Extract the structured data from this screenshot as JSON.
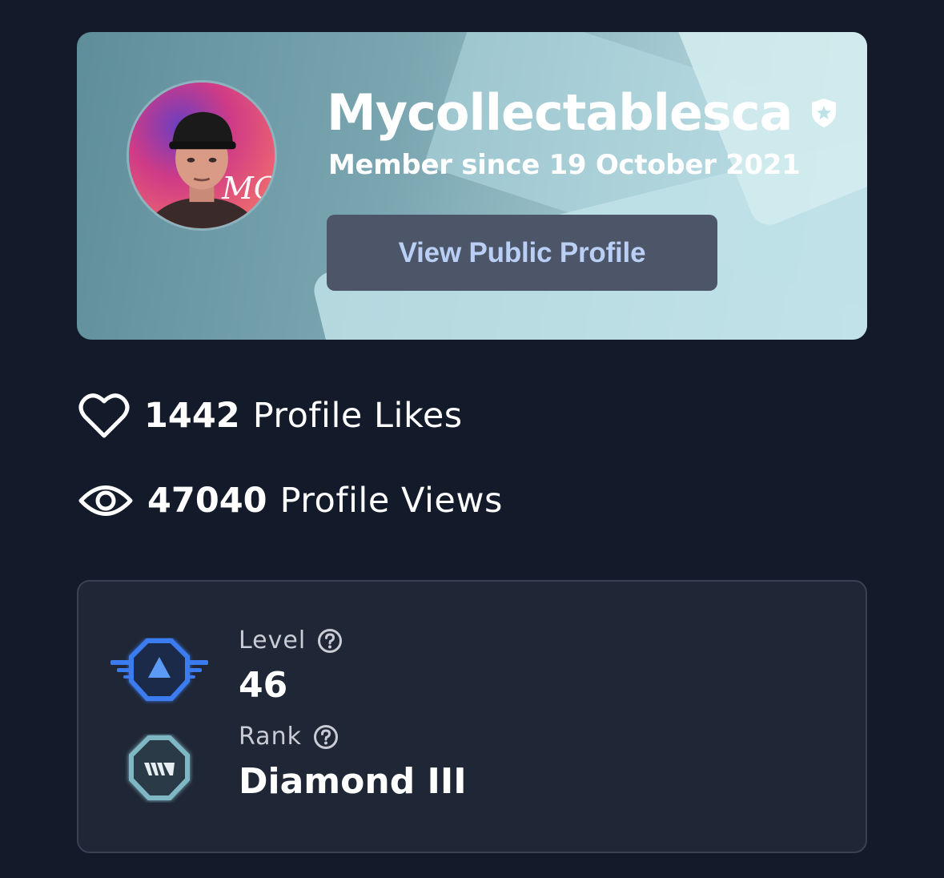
{
  "profile": {
    "username": "Mycollectablesca",
    "member_since": "Member since 19 October 2021",
    "view_profile_label": "View Public Profile",
    "avatar_monogram": "MC"
  },
  "stats": {
    "likes": {
      "value": "1442",
      "label": "Profile Likes",
      "icon": "heart-icon"
    },
    "views": {
      "value": "47040",
      "label": "Profile Views",
      "icon": "eye-icon"
    }
  },
  "progress": {
    "level": {
      "label": "Level",
      "value": "46",
      "icon": "level-badge-icon"
    },
    "rank": {
      "label": "Rank",
      "value": "Diamond III",
      "icon": "rank-badge-icon"
    }
  },
  "colors": {
    "background": "#131a29",
    "card": "#1f2636",
    "button": "#4d5669",
    "button_text": "#b9cff5",
    "level_badge": "#3b7bf0",
    "rank_badge": "#7fb8c4"
  }
}
